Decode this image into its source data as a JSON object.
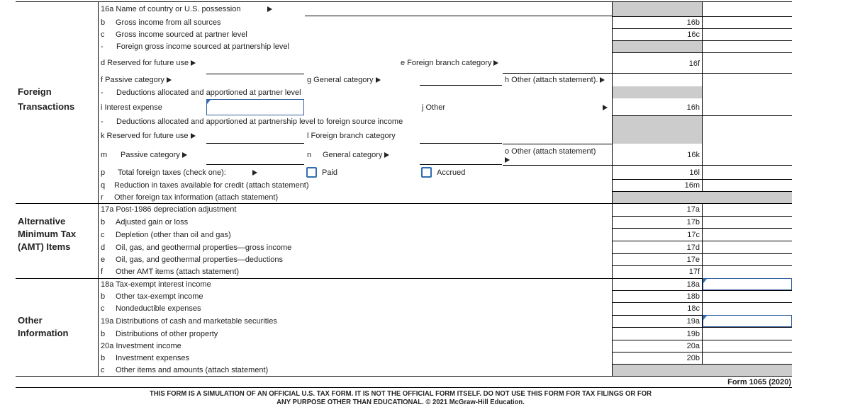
{
  "sections": {
    "foreign": [
      "Foreign",
      "Transactions"
    ],
    "amt": [
      "Alternative",
      "Minimum Tax",
      "(AMT) Items"
    ],
    "other": [
      "Other",
      "Information"
    ]
  },
  "lines": {
    "l16a": "16a Name of country or U.S. possession",
    "l16b_letter": "b",
    "l16b": "Gross income from all sources",
    "l16c_letter": "c",
    "l16c": "Gross income sourced at partner level",
    "l16dash1_letter": "-",
    "l16dash1": "Foreign gross income sourced at partnership level",
    "l16d": "d Reserved for future use",
    "l16e": "e Foreign branch category",
    "l16f": "f Passive category",
    "l16g": "g General category",
    "l16h": "h Other (attach statement).",
    "l16dash2_letter": "-",
    "l16dash2": "Deductions allocated and apportioned at partner level",
    "l16i": "i Interest expense",
    "l16j": "j Other",
    "l16dash3_letter": "-",
    "l16dash3": "Deductions allocated and apportioned at partnership level to foreign source income",
    "l16k": "k Reserved for future use",
    "l16l": "l Foreign branch category",
    "l16m_letter": "m",
    "l16m": "Passive category",
    "l16n_letter": "n",
    "l16n": "General category",
    "l16o": "o Other (attach statement)",
    "l16p_letter": "p",
    "l16p": "Total foreign taxes (check one):",
    "paid": "Paid",
    "accrued": "Accrued",
    "l16q_letter": "q",
    "l16q": "Reduction in taxes available for credit (attach statement)",
    "l16r_letter": "r",
    "l16r": "Other foreign tax information (attach statement)",
    "l17a": "17a Post-1986 depreciation adjustment",
    "l17b_letter": "b",
    "l17b": "Adjusted gain or loss",
    "l17c_letter": "c",
    "l17c": "Depletion (other than oil and gas)",
    "l17d_letter": "d",
    "l17d": "Oil, gas, and geothermal properties—gross income",
    "l17e_letter": "e",
    "l17e": "Oil, gas, and geothermal properties—deductions",
    "l17f_letter": "f",
    "l17f": "Other AMT items (attach statement)",
    "l18a": "18a Tax-exempt interest income",
    "l18b_letter": "b",
    "l18b": "Other tax-exempt income",
    "l18c_letter": "c",
    "l18c": "Nondeductible expenses",
    "l19a": "19a Distributions of cash and marketable securities",
    "l19b_letter": "b",
    "l19b": "Distributions of other property",
    "l20a": "20a Investment income",
    "l20b_letter": "b",
    "l20b": "Investment expenses",
    "l20c_letter": "c",
    "l20c": "Other items and amounts (attach statement)"
  },
  "codes": {
    "c16b": "16b",
    "c16c": "16c",
    "c16f": "16f",
    "c16h": "16h",
    "c16k": "16k",
    "c16l": "16l",
    "c16m": "16m",
    "c17a": "17a",
    "c17b": "17b",
    "c17c": "17c",
    "c17d": "17d",
    "c17e": "17e",
    "c17f": "17f",
    "c18a": "18a",
    "c18b": "18b",
    "c18c": "18c",
    "c19a": "19a",
    "c19b": "19b",
    "c20a": "20a",
    "c20b": "20b"
  },
  "inputs": {
    "interest_expense": "",
    "tax_exempt_interest": "",
    "distributions_cash": ""
  },
  "footer": {
    "form_name": "Form 1065 (2020)",
    "disclaimer_line1": "THIS FORM IS A SIMULATION OF AN OFFICIAL U.S. TAX FORM. IT IS NOT THE OFFICIAL FORM ITSELF. DO NOT USE THIS FORM FOR TAX FILINGS OR FOR",
    "disclaimer_line2": "ANY PURPOSE OTHER THAN EDUCATIONAL. © 2021 McGraw-Hill Education."
  }
}
